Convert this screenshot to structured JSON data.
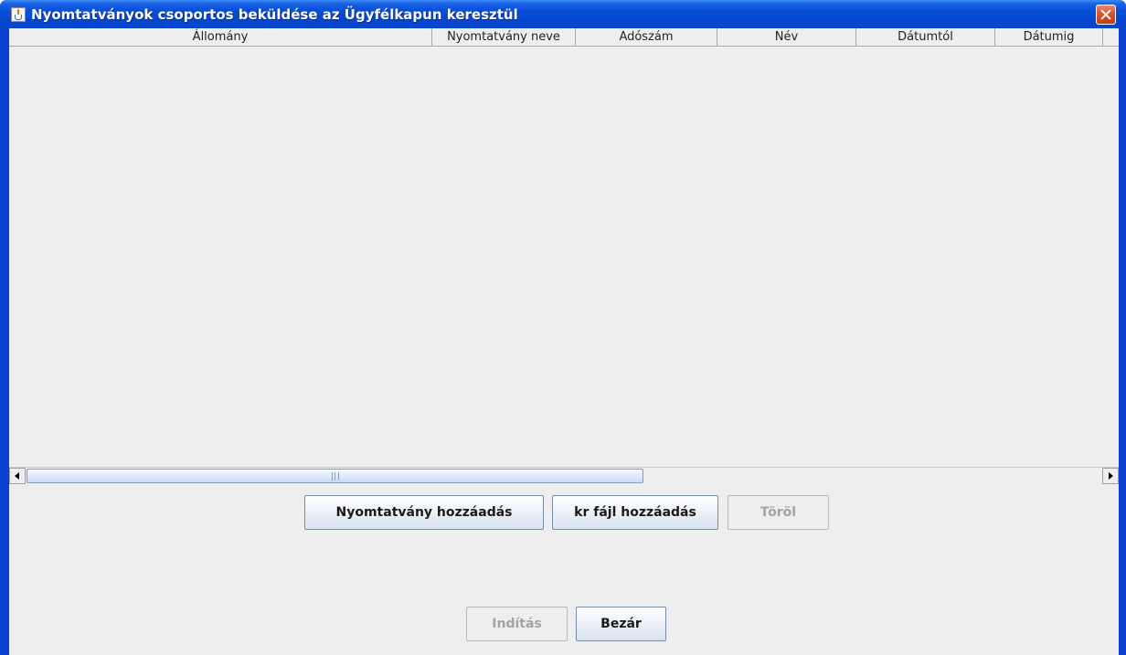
{
  "window": {
    "title": "Nyomtatványok csoportos beküldése az Ügyfélkapun keresztül",
    "icon": "java-cup-icon"
  },
  "table": {
    "columns": [
      "Állomány",
      "Nyomtatvány neve",
      "Adószám",
      "Név",
      "Dátumtól",
      "Dátumig"
    ],
    "rows": []
  },
  "actions": {
    "add_form_label": "Nyomtatvány hozzáadás",
    "add_kr_label": "kr fájl hozzáadás",
    "delete_label": "Töröl",
    "delete_enabled": false
  },
  "footer": {
    "start_label": "Indítás",
    "start_enabled": false,
    "close_label": "Bezár"
  }
}
